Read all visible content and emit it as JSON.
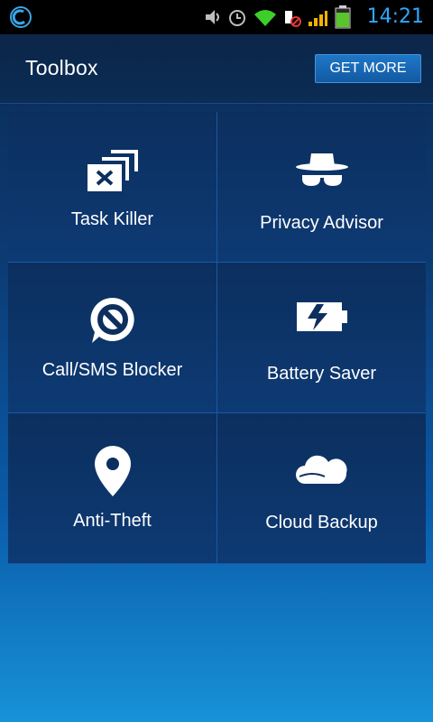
{
  "status_bar": {
    "time": "14:21",
    "icons": [
      "app-logo-icon",
      "volume-icon",
      "alarm-icon",
      "wifi-icon",
      "no-sim-icon",
      "signal-icon",
      "battery-icon"
    ]
  },
  "header": {
    "title": "Toolbox",
    "get_more_label": "GET MORE"
  },
  "tiles": [
    {
      "label": "Task Killer",
      "icon": "task-killer-icon"
    },
    {
      "label": "Privacy Advisor",
      "icon": "privacy-advisor-icon"
    },
    {
      "label": "Call/SMS Blocker",
      "icon": "blocker-icon"
    },
    {
      "label": "Battery Saver",
      "icon": "battery-saver-icon"
    },
    {
      "label": "Anti-Theft",
      "icon": "location-pin-icon"
    },
    {
      "label": "Cloud Backup",
      "icon": "cloud-icon"
    }
  ],
  "colors": {
    "accent": "#2ea8ff",
    "button": "#1766b5",
    "tile": "#0d3468",
    "divider": "#1a59a6"
  }
}
